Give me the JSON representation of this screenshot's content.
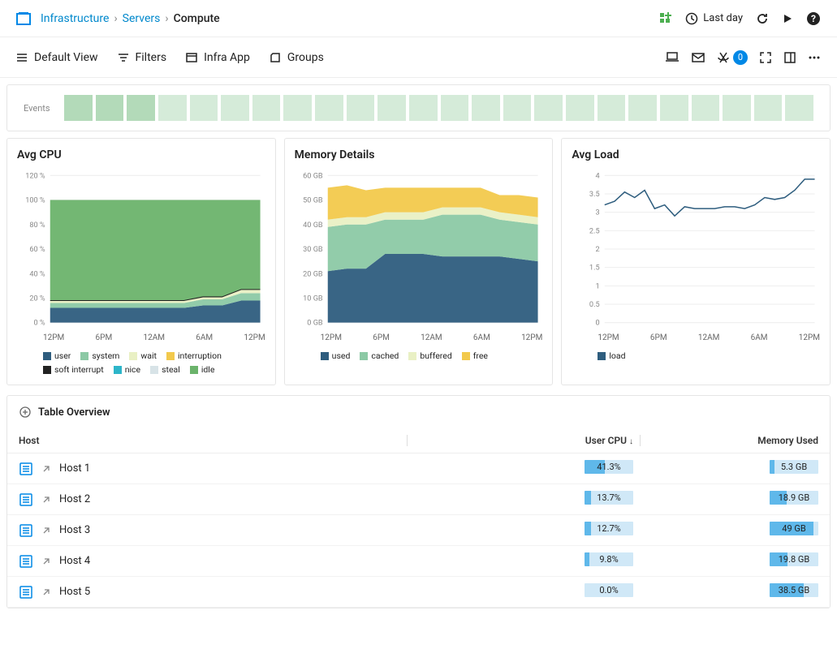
{
  "breadcrumb": {
    "root": "Infrastructure",
    "mid": "Servers",
    "current": "Compute"
  },
  "header": {
    "time_range": "Last day",
    "alert_count": "0"
  },
  "toolbar": {
    "view": "Default View",
    "filters": "Filters",
    "infra_app": "Infra App",
    "groups": "Groups"
  },
  "events": {
    "label": "Events",
    "boxes": [
      {
        "active": true
      },
      {
        "active": true
      },
      {
        "active": true
      },
      {
        "active": false
      },
      {
        "active": false
      },
      {
        "active": false
      },
      {
        "active": false
      },
      {
        "active": false
      },
      {
        "active": false
      },
      {
        "active": false
      },
      {
        "active": false
      },
      {
        "active": false
      },
      {
        "active": false
      },
      {
        "active": false
      },
      {
        "active": false
      },
      {
        "active": false
      },
      {
        "active": false
      },
      {
        "active": false
      },
      {
        "active": false
      },
      {
        "active": false
      },
      {
        "active": false
      },
      {
        "active": false
      },
      {
        "active": false
      },
      {
        "active": false
      }
    ]
  },
  "chart_data": [
    {
      "id": "avg_cpu",
      "title": "Avg CPU",
      "type": "area",
      "ylim": [
        0,
        120
      ],
      "yunit": "%",
      "yticks": [
        0,
        20,
        40,
        60,
        80,
        100,
        120
      ],
      "xlabels": [
        "12PM",
        "6PM",
        "12AM",
        "6AM",
        "12PM"
      ],
      "series": [
        {
          "name": "user",
          "color": "#2e5d7e",
          "values": [
            12,
            12,
            12,
            12,
            12,
            12,
            12,
            12,
            14,
            14,
            18,
            18
          ]
        },
        {
          "name": "system",
          "color": "#8cc9a5",
          "values": [
            4,
            4,
            4,
            4,
            4,
            4,
            4,
            4,
            5,
            5,
            6,
            6
          ]
        },
        {
          "name": "wait",
          "color": "#e9f0c4",
          "values": [
            2,
            2,
            2,
            2,
            2,
            2,
            2,
            2,
            2,
            2,
            3,
            3
          ]
        },
        {
          "name": "interruption",
          "color": "#f2c94c",
          "values": [
            0,
            0,
            0,
            0,
            0,
            0,
            0,
            0,
            0,
            0,
            0,
            0
          ]
        },
        {
          "name": "soft interrupt",
          "color": "#222222",
          "values": [
            0,
            0,
            0,
            0,
            0,
            0,
            0,
            0,
            0,
            0,
            0,
            0
          ]
        },
        {
          "name": "nice",
          "color": "#2db5c9",
          "values": [
            0,
            0,
            0,
            0,
            0,
            0,
            0,
            0,
            0,
            0,
            0,
            0
          ]
        },
        {
          "name": "steal",
          "color": "#d8e3e7",
          "values": [
            0,
            0,
            0,
            0,
            0,
            0,
            0,
            0,
            0,
            0,
            0,
            0
          ]
        },
        {
          "name": "idle",
          "color": "#6bb36b",
          "values": [
            82,
            82,
            82,
            82,
            82,
            82,
            82,
            82,
            79,
            79,
            73,
            73
          ]
        }
      ]
    },
    {
      "id": "memory",
      "title": "Memory Details",
      "type": "area",
      "ylim": [
        0,
        60
      ],
      "yunit": "GB",
      "yticks": [
        0,
        10,
        20,
        30,
        40,
        50,
        60
      ],
      "xlabels": [
        "12PM",
        "6PM",
        "12AM",
        "6AM",
        "12PM"
      ],
      "series": [
        {
          "name": "used",
          "color": "#2e5d7e",
          "values": [
            21,
            22,
            22,
            28,
            28,
            28,
            27,
            27,
            27,
            27,
            26,
            25
          ]
        },
        {
          "name": "cached",
          "color": "#8cc9a5",
          "values": [
            18,
            18,
            18,
            14,
            14,
            14,
            17,
            17,
            17,
            15,
            15,
            15
          ]
        },
        {
          "name": "buffered",
          "color": "#e9f0c4",
          "values": [
            3,
            3,
            3,
            3,
            3,
            3,
            3,
            3,
            3,
            3,
            3,
            3
          ]
        },
        {
          "name": "free",
          "color": "#f2c94c",
          "values": [
            13,
            13,
            11,
            10,
            10,
            10,
            8,
            8,
            8,
            7,
            8,
            8
          ]
        }
      ]
    },
    {
      "id": "avg_load",
      "title": "Avg Load",
      "type": "line",
      "ylim": [
        0,
        4
      ],
      "yunit": "",
      "yticks": [
        0,
        0.5,
        1,
        1.5,
        2,
        2.5,
        3,
        3.5,
        4
      ],
      "xlabels": [
        "12PM",
        "6PM",
        "12AM",
        "6AM",
        "12PM"
      ],
      "series": [
        {
          "name": "load",
          "color": "#2e5d7e",
          "values": [
            3.2,
            3.3,
            3.55,
            3.4,
            3.6,
            3.1,
            3.2,
            2.9,
            3.15,
            3.1,
            3.1,
            3.1,
            3.15,
            3.15,
            3.1,
            3.2,
            3.4,
            3.35,
            3.4,
            3.6,
            3.9,
            3.9
          ]
        }
      ]
    }
  ],
  "table": {
    "title": "Table Overview",
    "columns": {
      "host": "Host",
      "cpu": "User CPU",
      "mem": "Memory Used"
    },
    "sort_indicator": "↓",
    "rows": [
      {
        "host": "Host 1",
        "cpu": "41.3%",
        "cpu_pct": 41,
        "mem": "5.3 GB",
        "mem_pct": 10
      },
      {
        "host": "Host 2",
        "cpu": "13.7%",
        "cpu_pct": 14,
        "mem": "18.9 GB",
        "mem_pct": 35
      },
      {
        "host": "Host 3",
        "cpu": "12.7%",
        "cpu_pct": 13,
        "mem": "49 GB",
        "mem_pct": 90
      },
      {
        "host": "Host 4",
        "cpu": "9.8%",
        "cpu_pct": 10,
        "mem": "19.8 GB",
        "mem_pct": 37
      },
      {
        "host": "Host 5",
        "cpu": "0.0%",
        "cpu_pct": 0,
        "mem": "38.5 GB",
        "mem_pct": 70
      }
    ]
  }
}
